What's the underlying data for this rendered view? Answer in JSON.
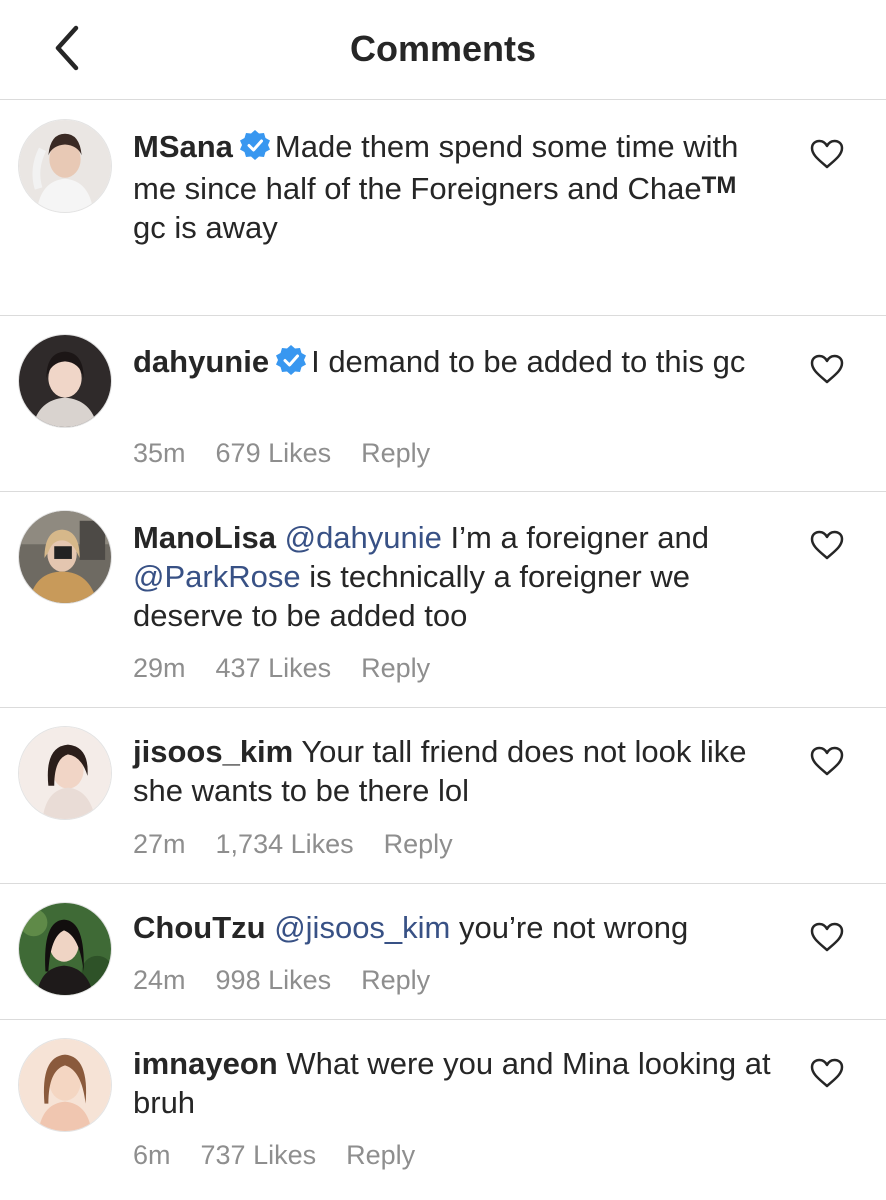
{
  "header": {
    "title": "Comments",
    "back_icon": "chevron-left-icon"
  },
  "colors": {
    "text": "#262626",
    "meta": "#8e8e8e",
    "mention": "#385185",
    "verified": "#3897f0",
    "divider": "#dbdbdb"
  },
  "comments": [
    {
      "username": "MSana",
      "verified": true,
      "text_before_tm": "Made them spend some time with me since half of the Foreigners and Chae",
      "tm": "TM",
      "text_after_tm": " gc is away"
    },
    {
      "username": "dahyunie",
      "verified": true,
      "text": "I demand to be added to this gc",
      "time": "35m",
      "likes": "679 Likes",
      "reply": "Reply"
    },
    {
      "username": "ManoLisa",
      "verified": false,
      "mention1": "@dahyunie",
      "text_mid": " I’m a foreigner and ",
      "mention2": "@ParkRose",
      "text_end": " is technically a foreigner we deserve to be added too",
      "time": "29m",
      "likes": "437 Likes",
      "reply": "Reply"
    },
    {
      "username": "jisoos_kim",
      "verified": false,
      "text": "Your tall friend does not look like she wants to be there lol",
      "time": "27m",
      "likes": "1,734 Likes",
      "reply": "Reply"
    },
    {
      "username": "ChouTzu",
      "verified": false,
      "mention1": "@jisoos_kim",
      "text": " you’re not wrong",
      "time": "24m",
      "likes": "998 Likes",
      "reply": "Reply"
    },
    {
      "username": "imnayeon",
      "verified": false,
      "text": "What were you and Mina looking at bruh",
      "time": "6m",
      "likes": "737 Likes",
      "reply": "Reply"
    }
  ]
}
